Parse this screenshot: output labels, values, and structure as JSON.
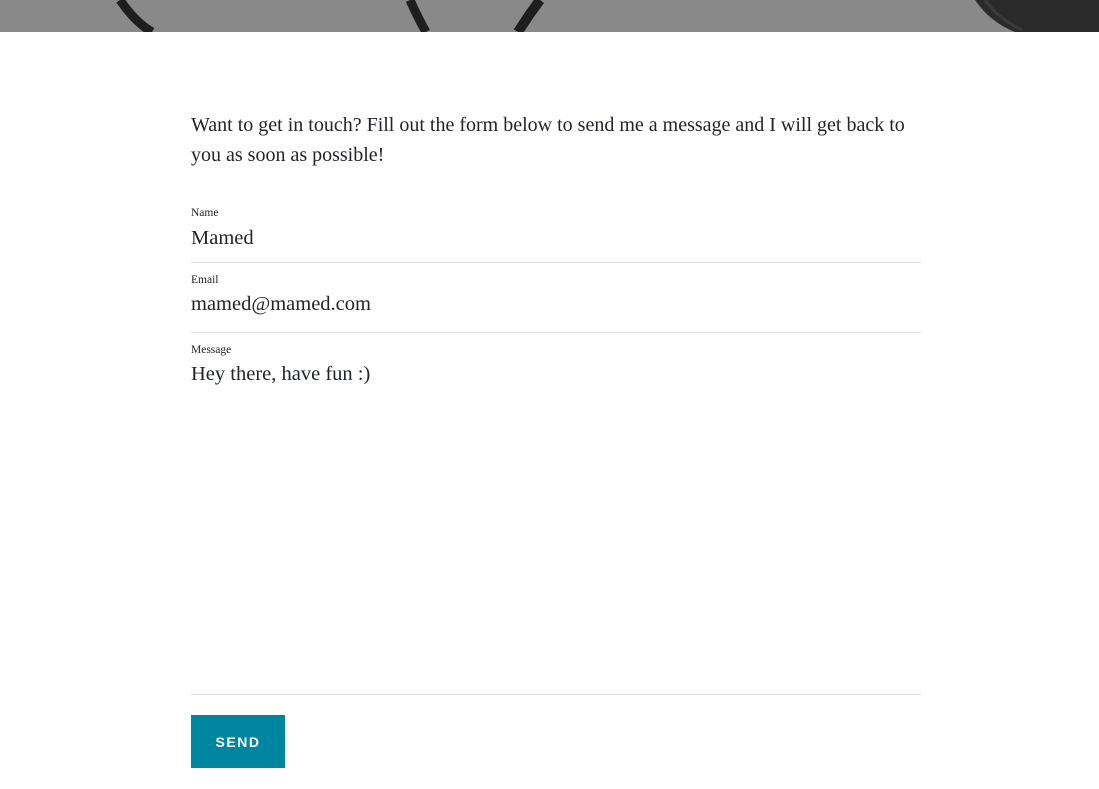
{
  "contact": {
    "intro": "Want to get in touch? Fill out the form below to send me a message and I will get back to you as soon as possible!"
  },
  "form": {
    "name": {
      "label": "Name",
      "value": "Mamed"
    },
    "email": {
      "label": "Email",
      "value": "mamed@mamed.com"
    },
    "message": {
      "label": "Message",
      "value": "Hey there, have fun :)"
    },
    "send_label": "Send"
  },
  "colors": {
    "accent": "#0085a1",
    "divider": "#dee2e6",
    "text": "#212529",
    "hero": "#888888"
  }
}
